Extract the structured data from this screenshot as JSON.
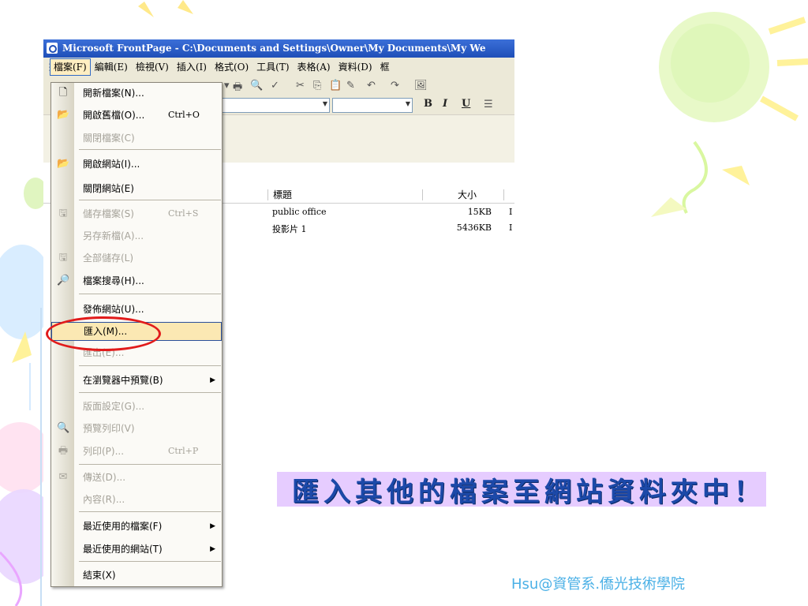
{
  "window": {
    "title": "Microsoft FrontPage - C:\\Documents and Settings\\Owner\\My Documents\\My We"
  },
  "menubar": {
    "items": [
      "檔案(F)",
      "編輯(E)",
      "檢視(V)",
      "插入(I)",
      "格式(O)",
      "工具(T)",
      "表格(A)",
      "資料(D)",
      "框"
    ]
  },
  "toolbar": {
    "format_buttons": [
      "B",
      "I",
      "U"
    ]
  },
  "file_list": {
    "columns": {
      "title": "標題",
      "size": "大小"
    },
    "rows": [
      {
        "title": "public office",
        "size": "15KB",
        "extra": "I"
      },
      {
        "title": "投影片 1",
        "size": "5436KB",
        "extra": "I"
      }
    ]
  },
  "file_menu": {
    "items": [
      {
        "label": "開新檔案(N)...",
        "shortcut": "",
        "icon": "new-file-icon",
        "disabled": false
      },
      {
        "label": "開啟舊檔(O)...",
        "shortcut": "Ctrl+O",
        "icon": "open-folder-icon",
        "disabled": false
      },
      {
        "label": "關閉檔案(C)",
        "shortcut": "",
        "icon": "",
        "disabled": true
      },
      {
        "label": "開啟網站(I)...",
        "shortcut": "",
        "icon": "open-web-icon",
        "disabled": false
      },
      {
        "label": "關閉網站(E)",
        "shortcut": "",
        "icon": "",
        "disabled": false
      },
      {
        "label": "儲存檔案(S)",
        "shortcut": "Ctrl+S",
        "icon": "save-icon",
        "disabled": true
      },
      {
        "label": "另存新檔(A)...",
        "shortcut": "",
        "icon": "",
        "disabled": true
      },
      {
        "label": "全部儲存(L)",
        "shortcut": "",
        "icon": "save-all-icon",
        "disabled": true
      },
      {
        "label": "檔案搜尋(H)...",
        "shortcut": "",
        "icon": "file-search-icon",
        "disabled": false
      },
      {
        "label": "發佈網站(U)...",
        "shortcut": "",
        "icon": "",
        "disabled": false
      },
      {
        "label": "匯入(M)...",
        "shortcut": "",
        "icon": "",
        "disabled": false,
        "highlighted": true
      },
      {
        "label": "匯出(E)...",
        "shortcut": "",
        "icon": "",
        "disabled": true
      },
      {
        "label": "在瀏覽器中預覽(B)",
        "shortcut": "",
        "icon": "",
        "disabled": false,
        "submenu": true
      },
      {
        "label": "版面設定(G)...",
        "shortcut": "",
        "icon": "",
        "disabled": true
      },
      {
        "label": "預覽列印(V)",
        "shortcut": "",
        "icon": "print-preview-icon",
        "disabled": true
      },
      {
        "label": "列印(P)...",
        "shortcut": "Ctrl+P",
        "icon": "print-icon",
        "disabled": true
      },
      {
        "label": "傳送(D)...",
        "shortcut": "",
        "icon": "send-icon",
        "disabled": true
      },
      {
        "label": "內容(R)...",
        "shortcut": "",
        "icon": "",
        "disabled": true
      },
      {
        "label": "最近使用的檔案(F)",
        "shortcut": "",
        "icon": "",
        "disabled": false,
        "submenu": true
      },
      {
        "label": "最近使用的網站(T)",
        "shortcut": "",
        "icon": "",
        "disabled": false,
        "submenu": true
      },
      {
        "label": "結束(X)",
        "shortcut": "",
        "icon": "",
        "disabled": false
      }
    ]
  },
  "caption": "匯入其他的檔案至網站資料夾中！",
  "credit": "Hsu@資管系.僑光技術學院",
  "colors": {
    "caption_bg": "#e6ccff",
    "caption_text": "#1c49a9",
    "highlight_ring": "#e11b1b",
    "credit_text": "#4ab0e6"
  }
}
